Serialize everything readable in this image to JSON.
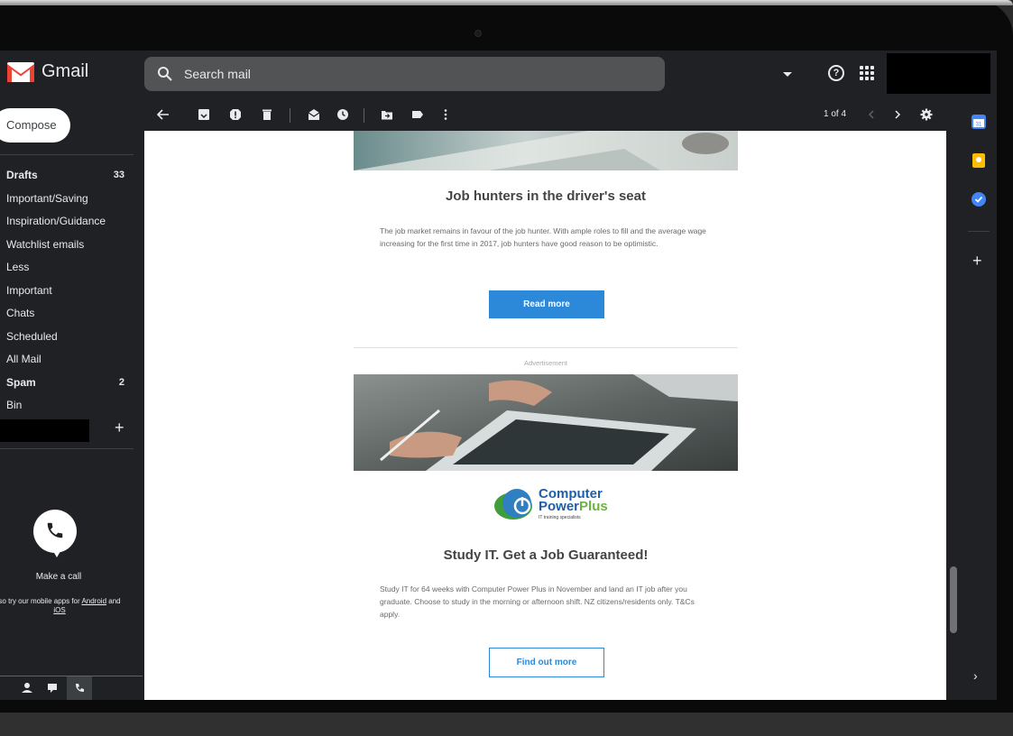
{
  "app": {
    "name": "Gmail"
  },
  "search": {
    "placeholder": "Search mail"
  },
  "sidebar": {
    "compose_label": "Compose",
    "items": [
      {
        "label": "Drafts",
        "count": "33",
        "bold": true
      },
      {
        "label": "Important/Saving",
        "count": "",
        "bold": false
      },
      {
        "label": "Inspiration/Guidance",
        "count": "",
        "bold": false
      },
      {
        "label": "Watchlist emails",
        "count": "",
        "bold": false
      },
      {
        "label": "Less",
        "count": "",
        "bold": false
      },
      {
        "label": "Important",
        "count": "",
        "bold": false
      },
      {
        "label": "Chats",
        "count": "",
        "bold": false
      },
      {
        "label": "Scheduled",
        "count": "",
        "bold": false
      },
      {
        "label": "All Mail",
        "count": "",
        "bold": false
      },
      {
        "label": "Spam",
        "count": "2",
        "bold": true
      },
      {
        "label": "Bin",
        "count": "",
        "bold": false
      }
    ],
    "labels_add": "+",
    "make_call": "Make a call",
    "mobile_note_prefix": "so try our mobile apps for ",
    "mobile_android": "Android",
    "mobile_and": " and ",
    "mobile_ios": "iOS"
  },
  "toolbar": {
    "pager": "1 of 4"
  },
  "email": {
    "article1": {
      "heading": "Job hunters in the driver's seat",
      "body": "The job market remains in favour of the job hunter. With ample roles to fill and the average wage increasing for the first time in 2017, job hunters have good reason to be optimistic.",
      "button": "Read more"
    },
    "ad_label": "Advertisement",
    "ad": {
      "logo_line1": "Computer",
      "logo_line2_a": "Power",
      "logo_line2_b": "Plus",
      "logo_tagline": "IT training specialists",
      "heading": "Study IT. Get a Job Guaranteed!",
      "body": "Study IT for 64 weeks with Computer Power Plus in November and land an IT job after you graduate. Choose to study in the morning or afternoon shift. NZ citizens/residents only. T&Cs apply.",
      "button": "Find out more"
    }
  },
  "right_panel": {
    "add": "+",
    "expand": "›"
  },
  "colors": {
    "accent_blue": "#2c89d9",
    "gmail_red": "#ea4335",
    "dark_bg": "#202124"
  },
  "icons": [
    "search-icon",
    "help-icon",
    "apps-icon",
    "back-icon",
    "archive-icon",
    "report-spam-icon",
    "delete-icon",
    "mark-unread-icon",
    "snooze-icon",
    "move-to-icon",
    "label-icon",
    "more-icon",
    "prev-icon",
    "next-icon",
    "settings-icon",
    "calendar-icon",
    "keep-icon",
    "tasks-icon",
    "phone-icon",
    "contacts-icon",
    "chat-icon"
  ]
}
